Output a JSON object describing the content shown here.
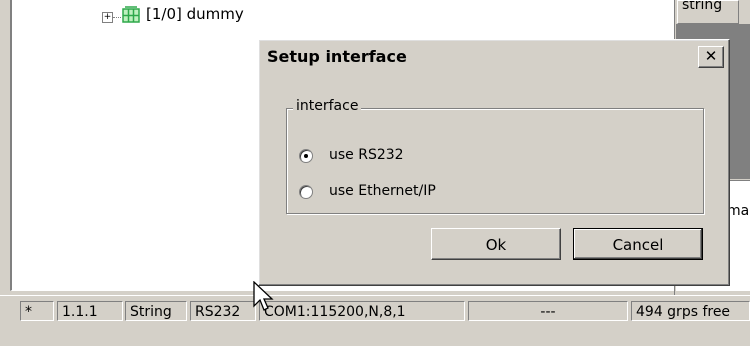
{
  "tree": {
    "node_label": "[1/0] dummy",
    "expander": "+"
  },
  "right_panel": {
    "top_cell_text": "string",
    "mid_cell_text": "ma"
  },
  "dialog": {
    "title": "Setup interface",
    "close_label": "✕",
    "group_label": "interface",
    "options": [
      {
        "label": "use RS232",
        "selected": true
      },
      {
        "label": "use Ethernet/IP",
        "selected": false
      }
    ],
    "ok_label": "Ok",
    "cancel_label": "Cancel"
  },
  "status_bar": {
    "asterisk": "*",
    "version": "1.1.1",
    "type": "String",
    "interface": "RS232",
    "port": "COM1:115200,N,8,1",
    "dash": "---",
    "free": "494 grps free"
  },
  "colors": {
    "face": "#d4d0c8",
    "shadow": "#808080",
    "node_icon": "#2ea84a"
  },
  "icons": {
    "tree_node": "grid-node-icon",
    "cursor": "arrow-cursor-icon"
  }
}
